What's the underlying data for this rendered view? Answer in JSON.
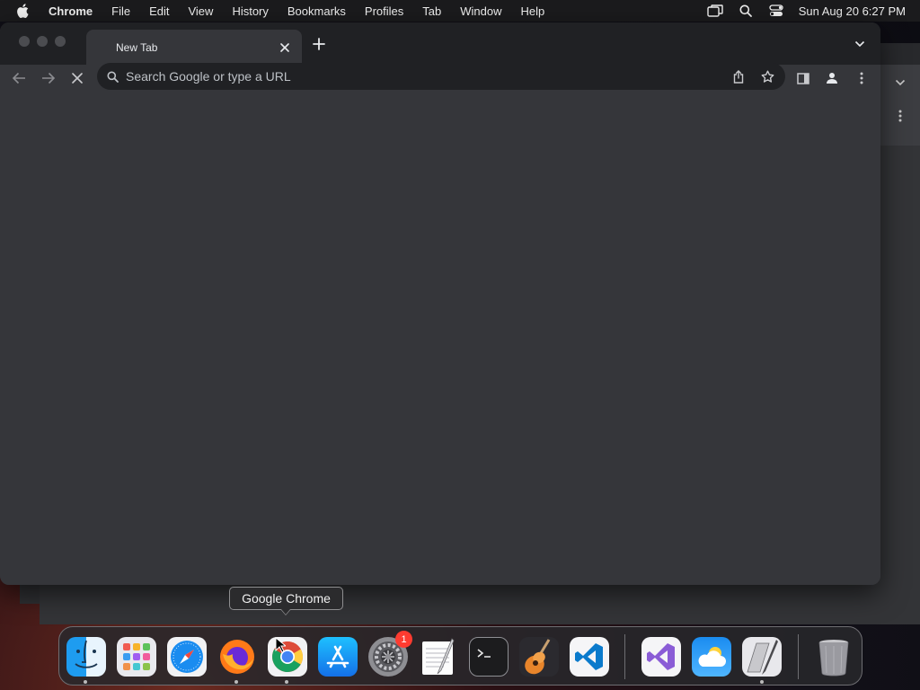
{
  "menubar": {
    "app_name": "Chrome",
    "items": [
      "File",
      "Edit",
      "View",
      "History",
      "Bookmarks",
      "Profiles",
      "Tab",
      "Window",
      "Help"
    ],
    "clock": "Sun Aug 20  6:27 PM"
  },
  "browser": {
    "tab_title": "New Tab",
    "omnibox_placeholder": "Search Google or type a URL"
  },
  "tooltip": {
    "text": "Google Chrome"
  },
  "dock": {
    "apps": [
      "Finder",
      "Launchpad",
      "Safari",
      "Firefox",
      "Google Chrome",
      "App Store",
      "System Settings",
      "TextEdit",
      "Terminal",
      "GarageBand",
      "Visual Studio Code",
      "Visual Studio",
      "Weather",
      "Script Editor",
      "Trash"
    ],
    "settings_badge": "1"
  },
  "colors": {
    "window_bg": "#35363a",
    "tabstrip_bg": "#202124",
    "omnibox_bg": "#202124",
    "badge": "#ff3b30"
  }
}
